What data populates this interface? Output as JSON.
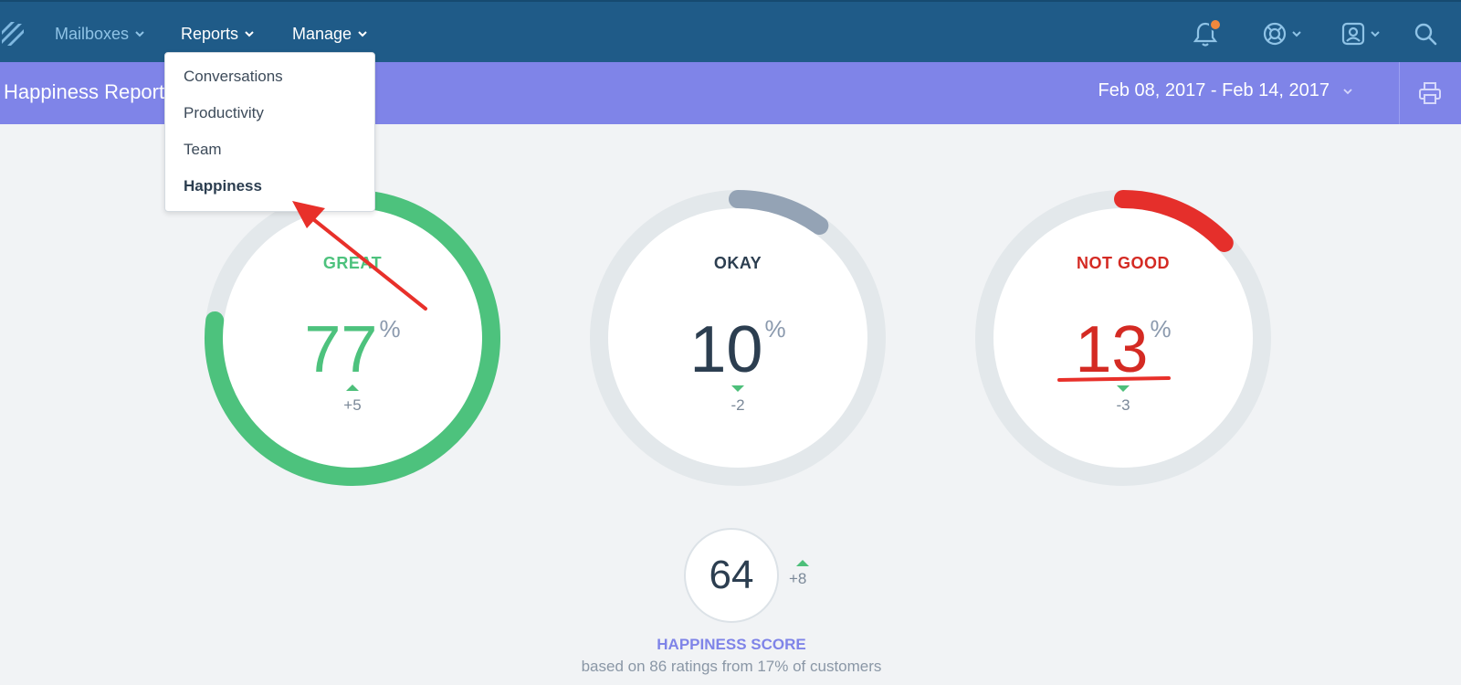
{
  "nav": {
    "items": [
      {
        "label": "Mailboxes",
        "state": "dim"
      },
      {
        "label": "Reports",
        "state": "active"
      },
      {
        "label": "Manage",
        "state": "active"
      }
    ],
    "right_icons": [
      "bell-icon",
      "lifebuoy-icon",
      "user-account-icon",
      "search-icon"
    ]
  },
  "subheader": {
    "title": "Happiness Report",
    "date_range": "Feb 08, 2017 - Feb 14, 2017"
  },
  "reports_menu": {
    "items": [
      "Conversations",
      "Productivity",
      "Team",
      "Happiness"
    ],
    "selected": "Happiness"
  },
  "ratings": [
    {
      "label": "GREAT",
      "value": "77",
      "unit": "%",
      "delta": "+5",
      "trend": "up",
      "fraction": 0.77,
      "color": "#4dc27d"
    },
    {
      "label": "OKAY",
      "value": "10",
      "unit": "%",
      "delta": "-2",
      "trend": "down",
      "fraction": 0.1,
      "color": "#94a3b5"
    },
    {
      "label": "NOT GOOD",
      "value": "13",
      "unit": "%",
      "delta": "-3",
      "trend": "down",
      "fraction": 0.13,
      "color": "#e52f2b"
    }
  ],
  "score": {
    "value": "64",
    "delta": "+8",
    "title": "HAPPINESS SCORE",
    "subtitle": "based on 86 ratings from 17% of customers"
  },
  "colors": {
    "nav_bg": "#1f5b88",
    "subheader_bg": "#7f84e8",
    "great": "#4dc27d",
    "okay": "#94a3b5",
    "not_good": "#e52f2b",
    "annotation": "#e8302a"
  }
}
